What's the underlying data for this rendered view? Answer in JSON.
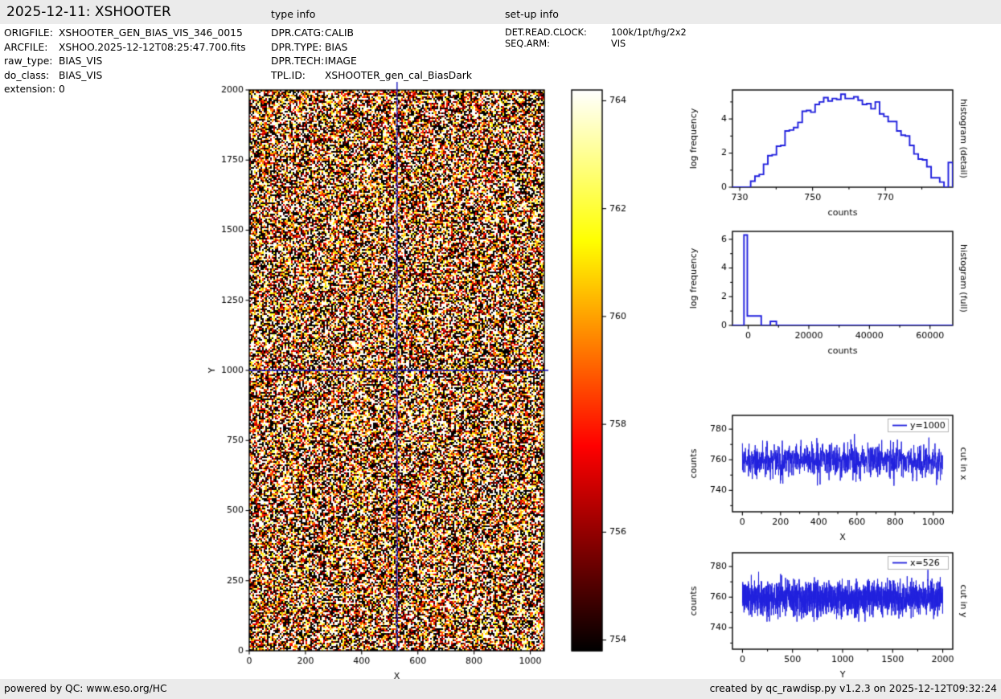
{
  "header": {
    "title": "2025-12-11: XSHOOTER",
    "type_info": "type info",
    "setup_info": "set-up info"
  },
  "file_info": [
    {
      "label": "ORIGFILE:",
      "value": "XSHOOTER_GEN_BIAS_VIS_346_0015"
    },
    {
      "label": "ARCFILE:",
      "value": "XSHOO.2025-12-12T08:25:47.700.fits"
    },
    {
      "label": "raw_type:",
      "value": "BIAS_VIS"
    },
    {
      "label": "do_class:",
      "value": "BIAS_VIS"
    },
    {
      "label": "extension:",
      "value": "0"
    }
  ],
  "type_info": [
    {
      "label": "DPR.CATG:",
      "value": "CALIB"
    },
    {
      "label": "DPR.TYPE:",
      "value": "BIAS"
    },
    {
      "label": "DPR.TECH:",
      "value": "IMAGE"
    },
    {
      "label": "TPL.ID:",
      "value": "XSHOOTER_gen_cal_BiasDark"
    }
  ],
  "setup_info": [
    {
      "label": "DET.READ.CLOCK:",
      "value": "100k/1pt/hg/2x2"
    },
    {
      "label": "SEQ.ARM:",
      "value": "VIS"
    }
  ],
  "footer": {
    "left": "powered by QC: www.eso.org/HC",
    "right": "created by qc_rawdisp.py v1.2.3 on 2025-12-12T09:32:24"
  },
  "colors": {
    "bar_bg": "#ebebeb",
    "plot_line": "#2020dd",
    "crosshair": "#0b0bbb",
    "spine": "#000000",
    "colormap": "hot"
  },
  "chart_data": [
    {
      "id": "main_image",
      "type": "heatmap",
      "xlabel": "X",
      "ylabel": "Y",
      "xlim": [
        0,
        1050
      ],
      "ylim": [
        0,
        2000
      ],
      "xticks": [
        0,
        200,
        400,
        600,
        800,
        1000
      ],
      "yticks": [
        0,
        250,
        500,
        750,
        1000,
        1250,
        1500,
        1750,
        2000
      ],
      "colormap": "hot",
      "vmin": 753.8,
      "vmax": 764.2,
      "noise": {
        "mean": 758.8,
        "sigma": 8.0,
        "seed": 1234
      },
      "colorbar": {
        "ticks": [
          754,
          756,
          758,
          760,
          762,
          764
        ]
      },
      "crosshair": {
        "x": 526,
        "y": 1000
      }
    },
    {
      "id": "hist_detail",
      "type": "step-histogram",
      "side_label": "histogram (detail)",
      "xlabel": "counts",
      "ylabel": "log frequency",
      "xlim": [
        728,
        788.5
      ],
      "ylim": [
        0,
        5.7
      ],
      "xticks": [
        730,
        750,
        770
      ],
      "minor_xticks": [
        740,
        760,
        780
      ],
      "yticks": [
        0,
        2,
        4
      ],
      "minor_yticks": [
        1,
        3,
        5
      ],
      "bins": {
        "x0": 733.0,
        "dx": 1.18
      },
      "heights": [
        0.35,
        0.65,
        0.75,
        1.35,
        1.85,
        1.9,
        2.4,
        2.45,
        3.3,
        3.35,
        3.5,
        3.8,
        4.45,
        4.5,
        4.4,
        4.85,
        5.0,
        5.25,
        5.05,
        5.2,
        5.15,
        5.45,
        5.2,
        5.2,
        5.3,
        5.1,
        4.85,
        4.9,
        4.6,
        5.0,
        4.3,
        4.15,
        3.85,
        3.85,
        3.3,
        3.05,
        3.0,
        2.45,
        1.95,
        1.65,
        1.6,
        1.2,
        0.55,
        0.55,
        0.3,
        0.0,
        1.45
      ]
    },
    {
      "id": "hist_full",
      "type": "step-path",
      "side_label": "histogram (full)",
      "xlabel": "counts",
      "ylabel": "log frequency",
      "xlim": [
        -5200,
        67500
      ],
      "ylim": [
        0,
        6.55
      ],
      "xticks": [
        0,
        20000,
        40000,
        60000
      ],
      "minor_xticks": [
        10000,
        30000,
        50000
      ],
      "yticks": [
        0,
        2,
        4,
        6
      ],
      "minor_yticks": [
        1,
        3,
        5
      ],
      "path": [
        [
          -5200,
          0
        ],
        [
          -1400,
          0
        ],
        [
          -1400,
          6.3
        ],
        [
          -300,
          6.3
        ],
        [
          -300,
          0.66
        ],
        [
          4300,
          0.66
        ],
        [
          4300,
          0
        ],
        [
          7300,
          0
        ],
        [
          7300,
          0.28
        ],
        [
          9300,
          0.28
        ],
        [
          9300,
          0
        ],
        [
          67500,
          0
        ]
      ]
    },
    {
      "id": "cut_x",
      "type": "noise-line",
      "side_label": "cut in x",
      "legend": "y=1000",
      "xlabel": "X",
      "ylabel": "counts",
      "xlim": [
        -52,
        1102
      ],
      "ylim": [
        726,
        789
      ],
      "xticks": [
        0,
        200,
        400,
        600,
        800,
        1000
      ],
      "minor_xticks": [
        100,
        300,
        500,
        700,
        900,
        1100
      ],
      "yticks": [
        740,
        760,
        780
      ],
      "minor_yticks": [
        730,
        750,
        770
      ],
      "noise": {
        "n": 1050,
        "mean": 759.3,
        "sigma": 5.3,
        "min": 743,
        "max": 778.5,
        "seed": 42
      }
    },
    {
      "id": "cut_y",
      "type": "noise-line",
      "side_label": "cut in y",
      "legend": "x=526",
      "xlabel": "Y",
      "ylabel": "counts",
      "xlim": [
        -100,
        2100
      ],
      "ylim": [
        726,
        789
      ],
      "xticks": [
        0,
        500,
        1000,
        1500,
        2000
      ],
      "minor_xticks": [
        250,
        750,
        1250,
        1750
      ],
      "yticks": [
        740,
        760,
        780
      ],
      "minor_yticks": [
        730,
        750,
        770
      ],
      "noise": {
        "n": 2000,
        "mean": 759.6,
        "sigma": 5.4,
        "min": 744,
        "max": 781,
        "seed": 99
      }
    }
  ]
}
